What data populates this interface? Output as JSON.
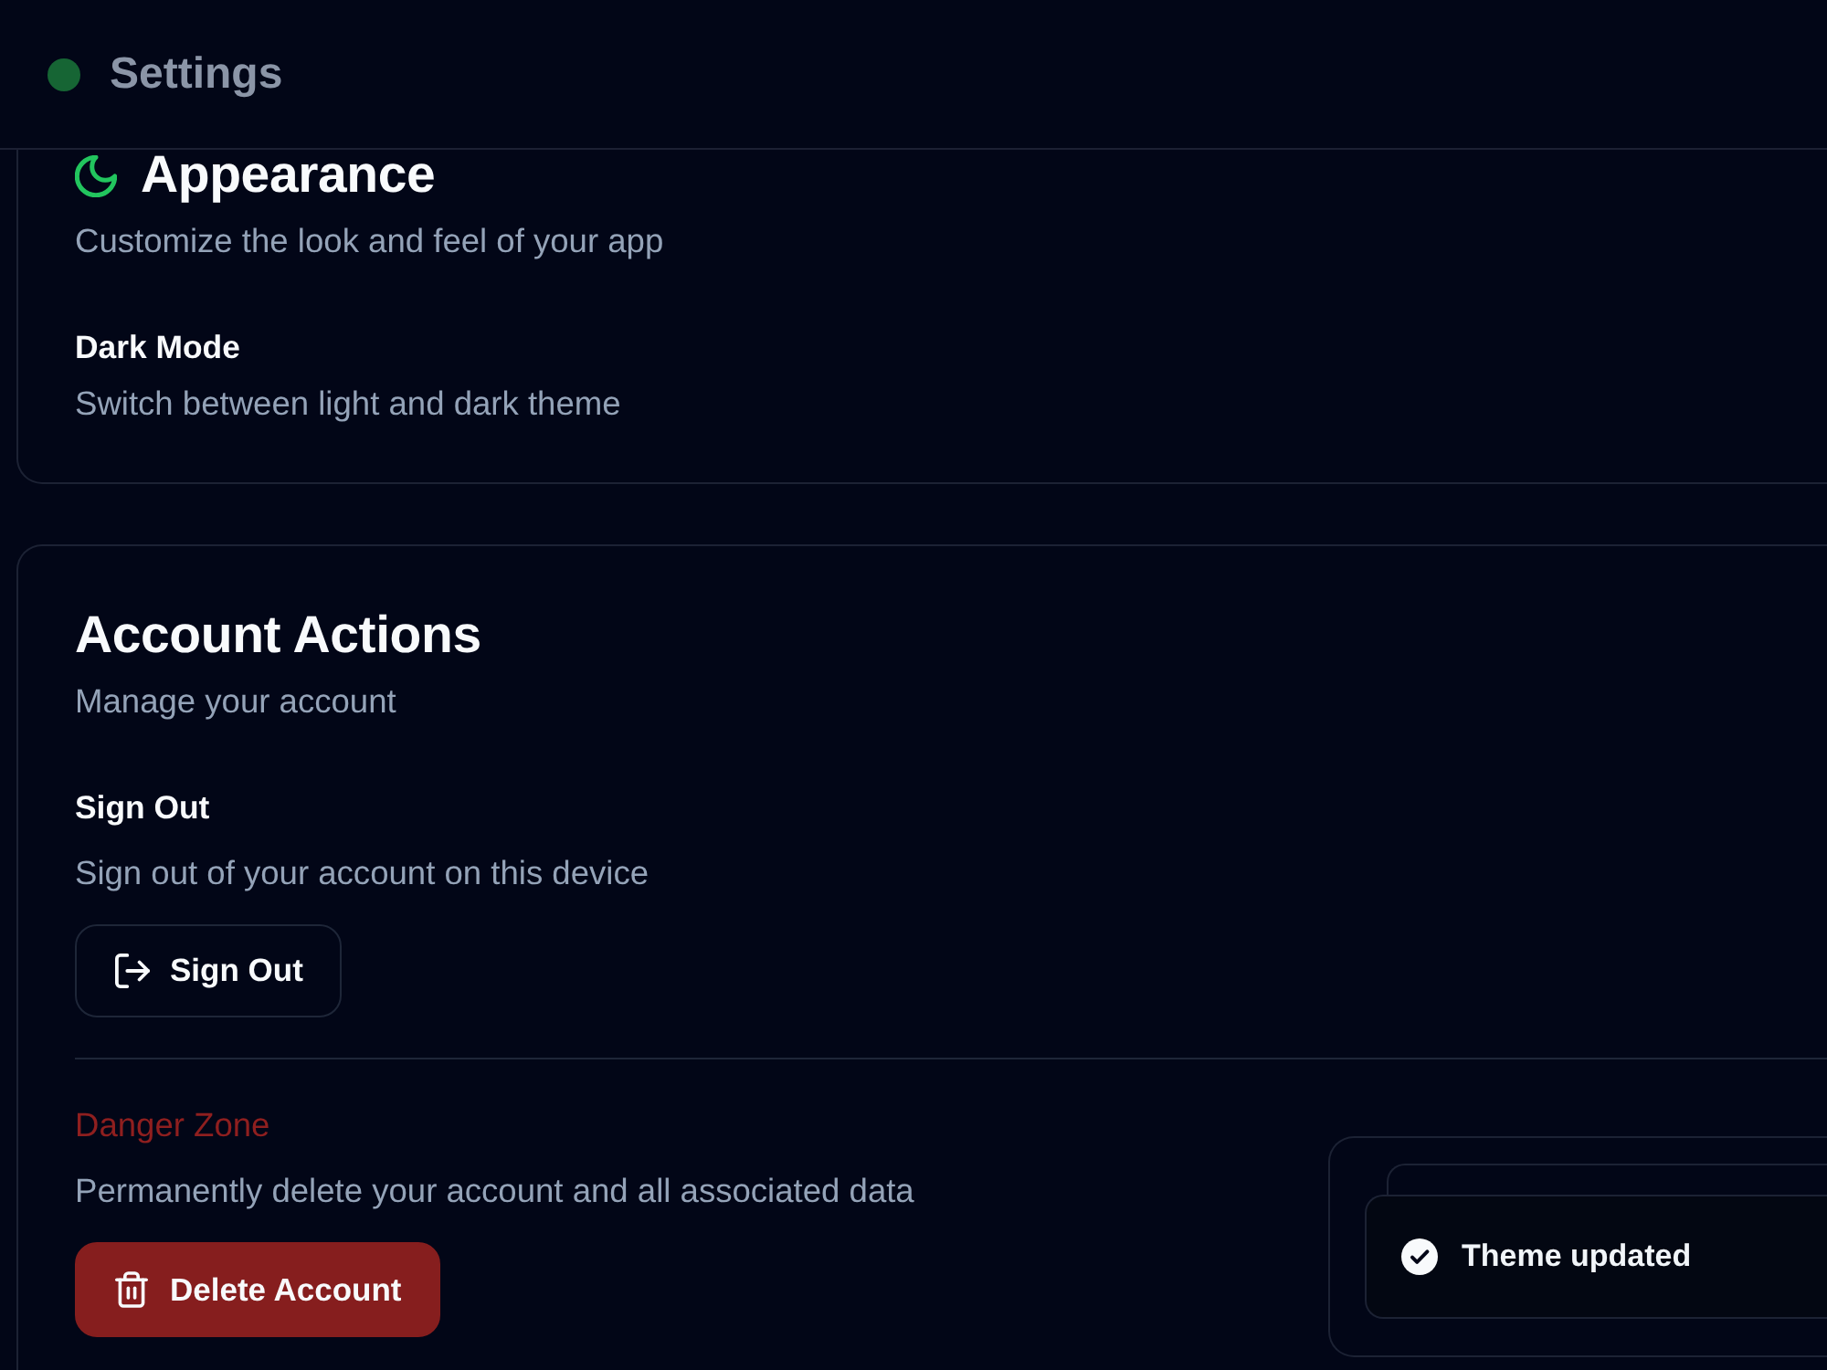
{
  "header": {
    "title": "Settings"
  },
  "sections": [
    {
      "title": "Appearance",
      "description": "Customize the look and feel of your app",
      "has_icon": true,
      "items": [
        {
          "kind": "setting",
          "label": "Dark Mode",
          "description": "Switch between light and dark theme"
        }
      ]
    },
    {
      "title": "Account Actions",
      "description": "Manage your account",
      "has_icon": false,
      "items": [
        {
          "kind": "action",
          "label": "Sign Out",
          "description": "Sign out of your account on this device",
          "button": "Sign Out"
        },
        {
          "kind": "danger",
          "label": "Danger Zone",
          "description": "Permanently delete your account and all associated data",
          "button": "Delete Account"
        }
      ]
    }
  ],
  "toast": {
    "kind": "success",
    "message": "Theme updated"
  }
}
